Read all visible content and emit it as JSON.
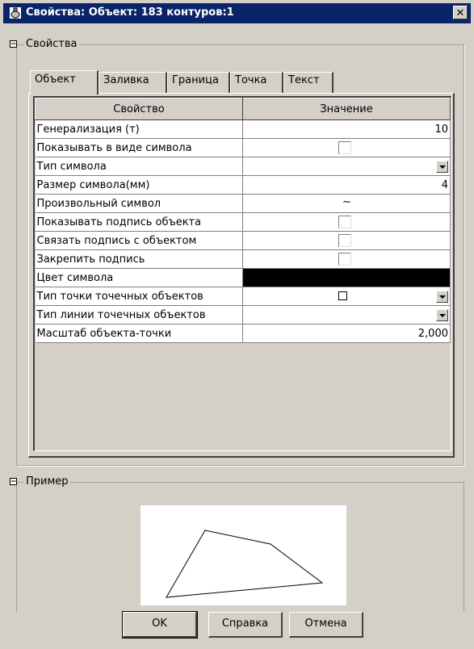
{
  "window": {
    "title": "Свойства: Объект: 183 контуров:1",
    "close_label": "✕"
  },
  "properties_group": {
    "toggle": "−",
    "label": "Свойства"
  },
  "tabs": [
    {
      "label": "Объект"
    },
    {
      "label": "Заливка"
    },
    {
      "label": "Граница"
    },
    {
      "label": "Точка"
    },
    {
      "label": "Текст"
    }
  ],
  "grid": {
    "headers": {
      "property": "Свойство",
      "value": "Значение"
    },
    "rows": [
      {
        "name": "Генерализация (т)",
        "value": "10"
      },
      {
        "name": "Показывать в виде символа",
        "value": ""
      },
      {
        "name": "Тип символа",
        "value": ""
      },
      {
        "name": "Размер символа(мм)",
        "value": "4"
      },
      {
        "name": "Произвольный символ",
        "value": "~"
      },
      {
        "name": "Показывать подпись объекта",
        "value": ""
      },
      {
        "name": "Связать подпись с объектом",
        "value": ""
      },
      {
        "name": "Закрепить подпись",
        "value": ""
      },
      {
        "name": "Цвет символа",
        "value": ""
      },
      {
        "name": "Тип точки точечных объектов",
        "value": ""
      },
      {
        "name": "Тип линии точечных объектов",
        "value": ""
      },
      {
        "name": "Масштаб объекта-точки",
        "value": "2,000"
      }
    ],
    "symbol_color": "#000000"
  },
  "example_group": {
    "toggle": "−",
    "label": "Пример"
  },
  "buttons": {
    "ok": "OK",
    "help": "Справка",
    "cancel": "Отмена"
  }
}
